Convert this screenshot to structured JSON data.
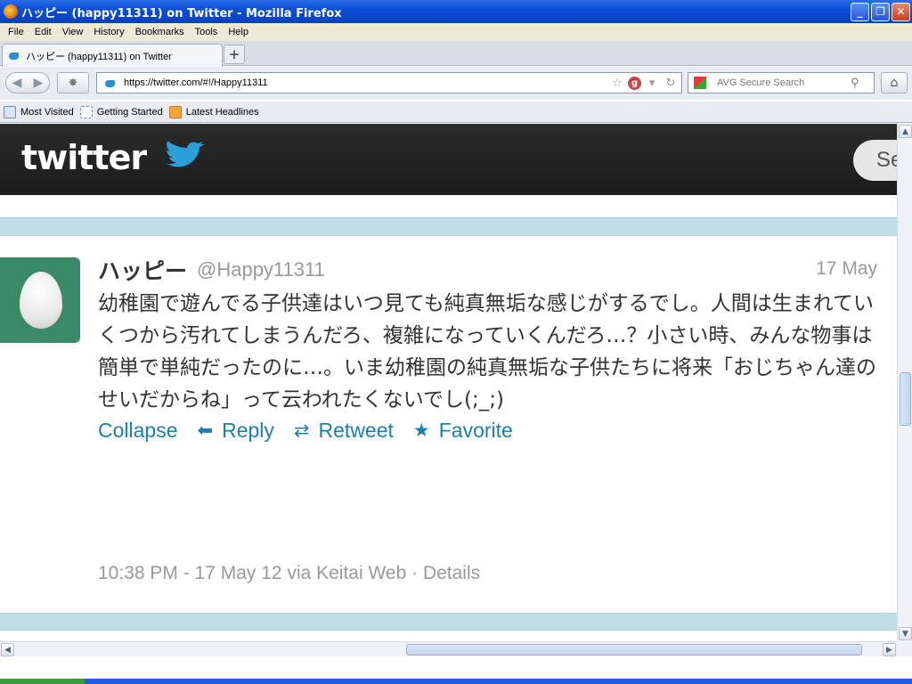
{
  "window": {
    "title": "ハッピー (happy11311) on Twitter - Mozilla Firefox",
    "minimize": "_",
    "restore": "❐",
    "close": "✕"
  },
  "menu": [
    "File",
    "Edit",
    "View",
    "History",
    "Bookmarks",
    "Tools",
    "Help"
  ],
  "tab": {
    "label": "ハッピー (happy11311) on Twitter",
    "new_tab": "+"
  },
  "nav": {
    "url": "https://twitter.com/#!/Happy11311",
    "search_placeholder": "AVG Secure Search"
  },
  "bookmarks": [
    "Most Visited",
    "Getting Started",
    "Latest Headlines"
  ],
  "twitter": {
    "logo": "twitter",
    "search_partial": "Se"
  },
  "tweet": {
    "name": "ハッピー",
    "handle": "@Happy11311",
    "date": "17 May",
    "text": "幼稚園で遊んでる子供達はいつ見ても純真無垢な感じがするでし。人間は生まれていくつから汚れてしまうんだろ、複雑になっていくんだろ…？小さい時、みんな物事は簡単で単純だったのに…。いま幼稚園の純真無垢な子供たちに将来「おじちゃん達のせいだからね」って云われたくないでし(;_;)",
    "actions": {
      "collapse": "Collapse",
      "reply": "Reply",
      "retweet": "Retweet",
      "favorite": "Favorite"
    },
    "meta": "10:38 PM - 17 May 12 via Keitai Web · Details"
  },
  "colors": {
    "link": "#1b7fae",
    "avatar_bg": "#3a8a6a",
    "page_bg": "#c0dde8",
    "header_bg": "#1c1c1c"
  }
}
